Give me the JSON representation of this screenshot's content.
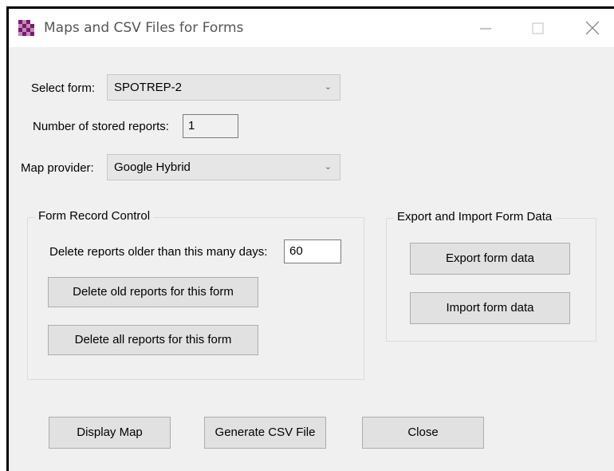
{
  "window": {
    "title": "Maps and CSV Files for Forms",
    "controls": {
      "minimize_icon": "minimize-icon",
      "maximize_icon": "maximize-icon",
      "close_icon": "close-icon"
    }
  },
  "form_select": {
    "label": "Select form:",
    "value": "SPOTREP-2"
  },
  "stored_reports": {
    "label": "Number of stored reports:",
    "value": "1"
  },
  "map_provider": {
    "label": "Map provider:",
    "value": "Google Hybrid"
  },
  "record_control": {
    "title": "Form Record Control",
    "days_label": "Delete reports older than this many days:",
    "days_value": "60",
    "delete_old_label": "Delete old reports for this form",
    "delete_all_label": "Delete all reports for this form"
  },
  "export_import": {
    "title": "Export and Import Form Data",
    "export_label": "Export form data",
    "import_label": "Import form data"
  },
  "footer": {
    "display_map_label": "Display Map",
    "generate_csv_label": "Generate CSV File",
    "close_label": "Close"
  },
  "colors": {
    "window_bg": "#f0f0f0",
    "button_bg": "#e1e1e1",
    "border": "#adadad",
    "icon_accent": "#7b1a6e"
  }
}
